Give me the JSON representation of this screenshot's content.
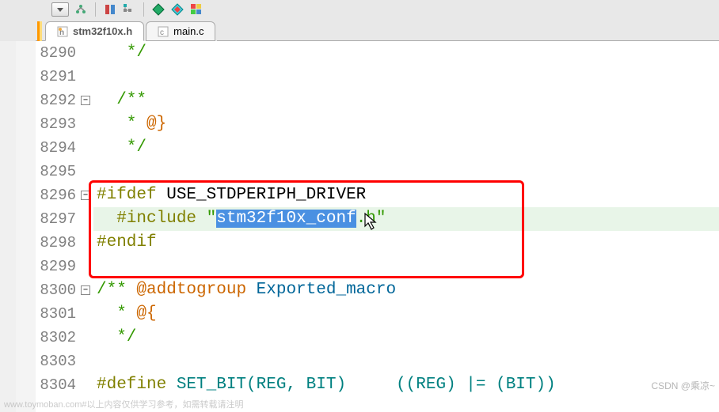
{
  "tabs": {
    "active": {
      "label": "stm32f10x.h"
    },
    "inactive": {
      "label": "main.c"
    }
  },
  "lines": {
    "l8290": {
      "num": "8290",
      "text": "   */ "
    },
    "l8291": {
      "num": "8291",
      "text": ""
    },
    "l8292": {
      "num": "8292",
      "text": "  /**"
    },
    "l8293": {
      "num": "8293",
      "text": "   * @}",
      "tag": "@}"
    },
    "l8294": {
      "num": "8294",
      "text": "   */ "
    },
    "l8295": {
      "num": "8295",
      "text": ""
    },
    "l8296": {
      "num": "8296",
      "ifdef": "#ifdef",
      "macro": " USE_STDPERIPH_DRIVER"
    },
    "l8297": {
      "num": "8297",
      "include": "  #include",
      "q1": " \"",
      "sel": "stm32f10x_conf",
      "q2": ".h\""
    },
    "l8298": {
      "num": "8298",
      "endif": "#endif"
    },
    "l8299": {
      "num": "8299",
      "text": ""
    },
    "l8300": {
      "num": "8300",
      "c1": "/** ",
      "tag": "@addtogroup",
      "id": " Exported_macro"
    },
    "l8301": {
      "num": "8301",
      "c1": "  * ",
      "tag": "@{"
    },
    "l8302": {
      "num": "8302",
      "text": "  */"
    },
    "l8303": {
      "num": "8303",
      "text": ""
    },
    "l8304": {
      "num": "8304",
      "kw": "#define",
      "name": " SET_BIT(REG, BIT)     ((REG) |= (BIT))"
    }
  },
  "watermark": {
    "left": "www.toymoban.com#以上内容仅供学习参考，如需转载请注明",
    "right": "CSDN @乘凉~"
  }
}
